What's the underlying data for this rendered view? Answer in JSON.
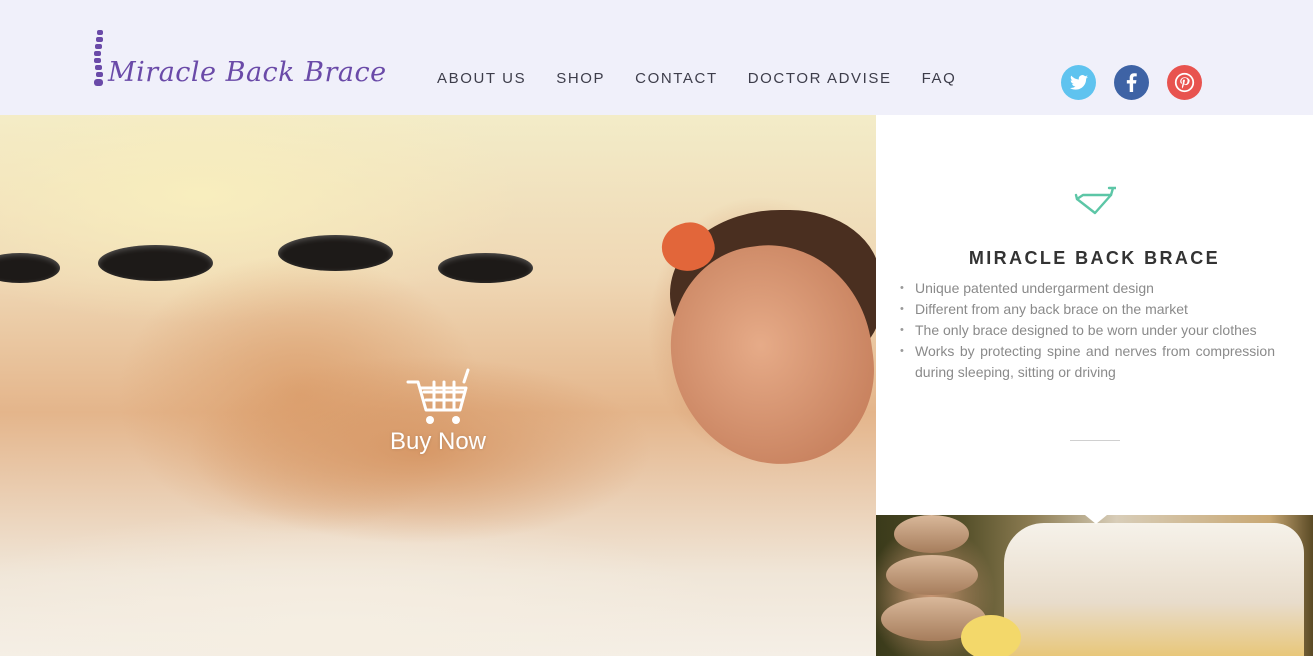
{
  "brand": {
    "logo_text": "Miracle Back Brace",
    "accent_color": "#6a4aa8"
  },
  "nav": {
    "items": [
      {
        "label": "ABOUT US"
      },
      {
        "label": "SHOP"
      },
      {
        "label": "CONTACT"
      },
      {
        "label": "DOCTOR ADVISE"
      },
      {
        "label": "FAQ"
      }
    ]
  },
  "social": [
    {
      "icon": "twitter-icon",
      "color": "#5fc3ef"
    },
    {
      "icon": "facebook-icon",
      "color": "#3e63a5"
    },
    {
      "icon": "pinterest-icon",
      "color": "#e8534f"
    }
  ],
  "hero": {
    "image": "woman-hot-stone-massage-photo",
    "buy_label": "Buy Now",
    "buy_icon": "shopping-cart-icon"
  },
  "feature": {
    "icon": "bicycle-frame-icon",
    "icon_color": "#5cc6a6",
    "title": "MIRACLE BACK BRACE",
    "bullets": [
      "Unique patented undergarment design",
      "Different from any back brace on the  market",
      "The only brace designed to be worn under your clothes",
      "Works by protecting spine and nerves from compression during sleeping, sitting or driving"
    ]
  },
  "spa_image": "spa-stones-towel-orchid-photo"
}
